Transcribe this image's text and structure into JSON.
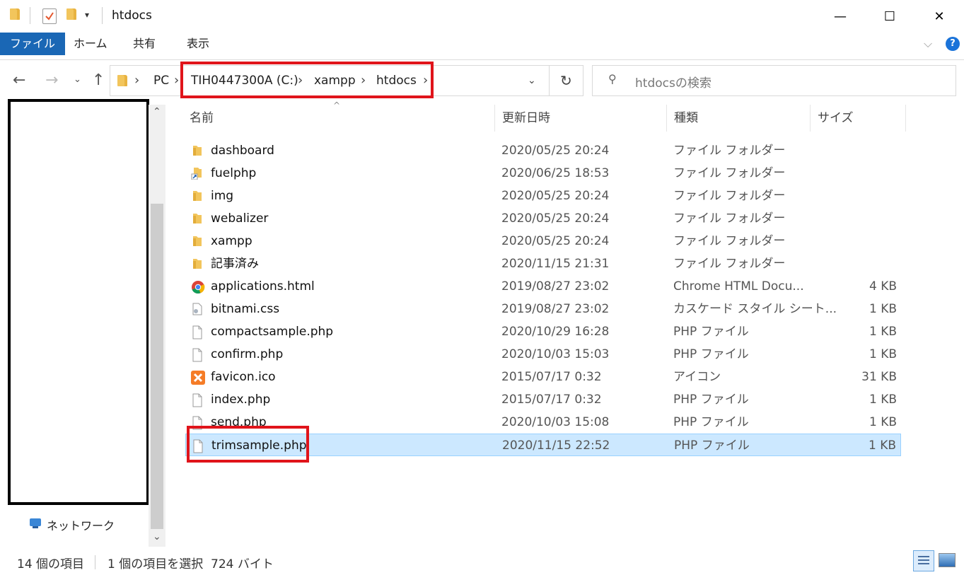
{
  "window": {
    "title": "htdocs",
    "minimize": "—",
    "maximize": "☐",
    "close": "✕"
  },
  "ribbon": {
    "tabs": [
      "ファイル",
      "ホーム",
      "共有",
      "表示"
    ],
    "help": "?"
  },
  "address": {
    "crumbs": [
      "PC",
      "TIH0447300A (C:)",
      "xampp",
      "htdocs"
    ],
    "search_placeholder": "htdocsの検索"
  },
  "columns": {
    "name": "名前",
    "date": "更新日時",
    "type": "種類",
    "size": "サイズ"
  },
  "files": [
    {
      "name": "dashboard",
      "date": "2020/05/25 20:24",
      "type": "ファイル フォルダー",
      "size": "",
      "icon": "folder-icon"
    },
    {
      "name": "fuelphp",
      "date": "2020/06/25 18:53",
      "type": "ファイル フォルダー",
      "size": "",
      "icon": "shortcut-icon"
    },
    {
      "name": "img",
      "date": "2020/05/25 20:24",
      "type": "ファイル フォルダー",
      "size": "",
      "icon": "folder-icon"
    },
    {
      "name": "webalizer",
      "date": "2020/05/25 20:24",
      "type": "ファイル フォルダー",
      "size": "",
      "icon": "folder-icon"
    },
    {
      "name": "xampp",
      "date": "2020/05/25 20:24",
      "type": "ファイル フォルダー",
      "size": "",
      "icon": "folder-icon"
    },
    {
      "name": "記事済み",
      "date": "2020/11/15 21:31",
      "type": "ファイル フォルダー",
      "size": "",
      "icon": "folder-icon"
    },
    {
      "name": "applications.html",
      "date": "2019/08/27 23:02",
      "type": "Chrome HTML Docu...",
      "size": "4 KB",
      "icon": "chrome-icon"
    },
    {
      "name": "bitnami.css",
      "date": "2019/08/27 23:02",
      "type": "カスケード スタイル シート...",
      "size": "1 KB",
      "icon": "css-file-icon"
    },
    {
      "name": "compactsample.php",
      "date": "2020/10/29 16:28",
      "type": "PHP ファイル",
      "size": "1 KB",
      "icon": "file-icon"
    },
    {
      "name": "confirm.php",
      "date": "2020/10/03 15:03",
      "type": "PHP ファイル",
      "size": "1 KB",
      "icon": "file-icon"
    },
    {
      "name": "favicon.ico",
      "date": "2015/07/17 0:32",
      "type": "アイコン",
      "size": "31 KB",
      "icon": "xampp-icon"
    },
    {
      "name": "index.php",
      "date": "2015/07/17 0:32",
      "type": "PHP ファイル",
      "size": "1 KB",
      "icon": "file-icon"
    },
    {
      "name": "send.php",
      "date": "2020/10/03 15:08",
      "type": "PHP ファイル",
      "size": "1 KB",
      "icon": "file-icon"
    },
    {
      "name": "trimsample.php",
      "date": "2020/11/15 22:52",
      "type": "PHP ファイル",
      "size": "1 KB",
      "icon": "file-icon",
      "selected": true
    }
  ],
  "nav": {
    "network_label": "ネットワーク"
  },
  "status": {
    "count": "14 個の項目",
    "selection": "1 個の項目を選択  724 バイト"
  },
  "colors": {
    "accent": "#1a67b5",
    "selection": "#cce8ff",
    "highlight": "#e0141b"
  }
}
